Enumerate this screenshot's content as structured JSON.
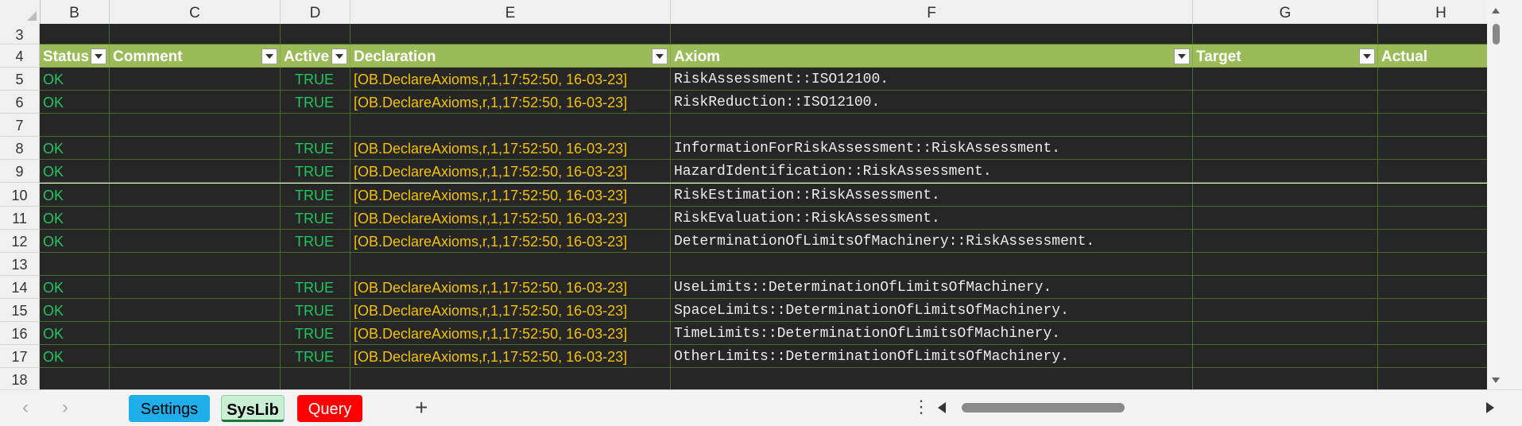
{
  "columns": [
    "B",
    "C",
    "D",
    "E",
    "F",
    "G",
    "H"
  ],
  "table_header": {
    "row_number": "4",
    "labels": [
      "Status",
      "Comment",
      "Active",
      "Declaration",
      "Axiom",
      "Target",
      "Actual"
    ]
  },
  "top_row_number": "3",
  "rows": [
    {
      "num": "5",
      "status": "OK",
      "comment": "",
      "active": "TRUE",
      "declaration": "[OB.DeclareAxioms,r,1,17:52:50, 16-03-23]",
      "axiom": "RiskAssessment::ISO12100."
    },
    {
      "num": "6",
      "status": "OK",
      "comment": "",
      "active": "TRUE",
      "declaration": "[OB.DeclareAxioms,r,1,17:52:50, 16-03-23]",
      "axiom": "RiskReduction::ISO12100."
    },
    {
      "num": "7",
      "status": "",
      "comment": "",
      "active": "",
      "declaration": "",
      "axiom": ""
    },
    {
      "num": "8",
      "status": "OK",
      "comment": "",
      "active": "TRUE",
      "declaration": "[OB.DeclareAxioms,r,1,17:52:50, 16-03-23]",
      "axiom": "InformationForRiskAssessment::RiskAssessment."
    },
    {
      "num": "9",
      "status": "OK",
      "comment": "",
      "active": "TRUE",
      "declaration": "[OB.DeclareAxioms,r,1,17:52:50, 16-03-23]",
      "axiom": "HazardIdentification::RiskAssessment."
    },
    {
      "num": "10",
      "status": "OK",
      "comment": "",
      "active": "TRUE",
      "declaration": "[OB.DeclareAxioms,r,1,17:52:50, 16-03-23]",
      "axiom": "RiskEstimation::RiskAssessment."
    },
    {
      "num": "11",
      "status": "OK",
      "comment": "",
      "active": "TRUE",
      "declaration": "[OB.DeclareAxioms,r,1,17:52:50, 16-03-23]",
      "axiom": "RiskEvaluation::RiskAssessment."
    },
    {
      "num": "12",
      "status": "OK",
      "comment": "",
      "active": "TRUE",
      "declaration": "[OB.DeclareAxioms,r,1,17:52:50, 16-03-23]",
      "axiom": "DeterminationOfLimitsOfMachinery::RiskAssessment."
    },
    {
      "num": "13",
      "status": "",
      "comment": "",
      "active": "",
      "declaration": "",
      "axiom": ""
    },
    {
      "num": "14",
      "status": "OK",
      "comment": "",
      "active": "TRUE",
      "declaration": "[OB.DeclareAxioms,r,1,17:52:50, 16-03-23]",
      "axiom": "UseLimits::DeterminationOfLimitsOfMachinery."
    },
    {
      "num": "15",
      "status": "OK",
      "comment": "",
      "active": "TRUE",
      "declaration": "[OB.DeclareAxioms,r,1,17:52:50, 16-03-23]",
      "axiom": "SpaceLimits::DeterminationOfLimitsOfMachinery."
    },
    {
      "num": "16",
      "status": "OK",
      "comment": "",
      "active": "TRUE",
      "declaration": "[OB.DeclareAxioms,r,1,17:52:50, 16-03-23]",
      "axiom": "TimeLimits::DeterminationOfLimitsOfMachinery."
    },
    {
      "num": "17",
      "status": "OK",
      "comment": "",
      "active": "TRUE",
      "declaration": "[OB.DeclareAxioms,r,1,17:52:50, 16-03-23]",
      "axiom": "OtherLimits::DeterminationOfLimitsOfMachinery."
    },
    {
      "num": "18",
      "status": "",
      "comment": "",
      "active": "",
      "declaration": "",
      "axiom": ""
    }
  ],
  "sheet_tabs": [
    {
      "label": "Settings",
      "bg": "#1eaeea",
      "color": "#000000",
      "active": false
    },
    {
      "label": "SysLib",
      "bg": "#c8efd4",
      "color": "#000000",
      "active": true
    },
    {
      "label": "Query",
      "bg": "#ff0000",
      "color": "#ffffff",
      "active": false
    }
  ],
  "icons": {
    "prev_sheet": "‹",
    "next_sheet": "›",
    "add_sheet": "+",
    "more_options": "⋮"
  },
  "colors": {
    "header_band": "#9bbb59",
    "status_ok": "#21c55d",
    "declaration": "#f2c200",
    "cell_bg": "#262626"
  }
}
